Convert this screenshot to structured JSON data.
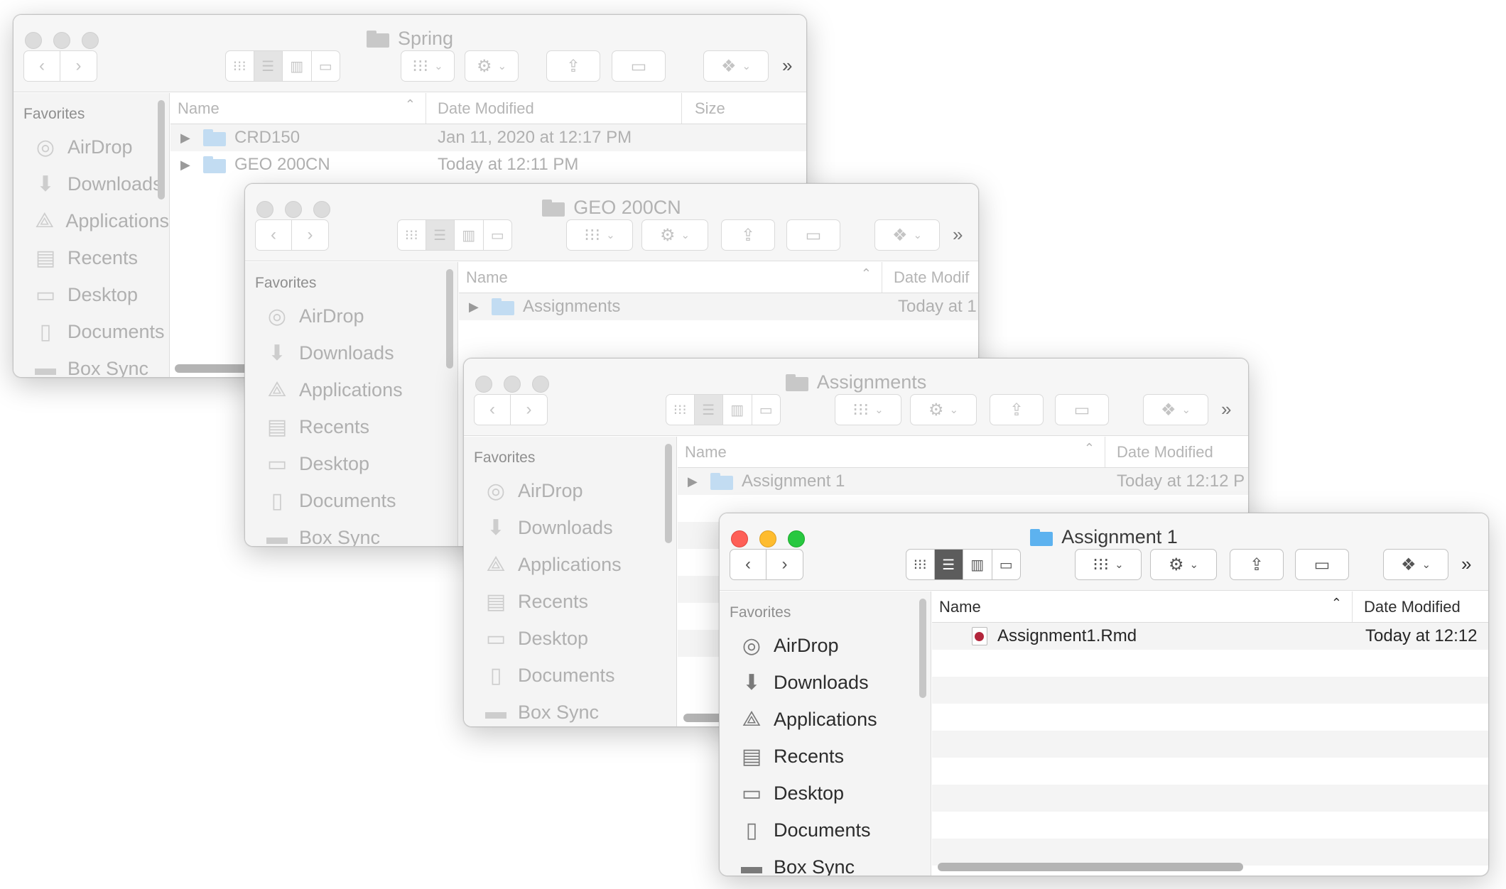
{
  "toolbar": {
    "back": "‹",
    "forward": "›",
    "more": "»",
    "icons": [
      "back-icon",
      "forward-icon",
      "icon-view-icon",
      "list-view-icon",
      "column-view-icon",
      "gallery-view-icon",
      "group-icon",
      "gear-icon",
      "share-icon",
      "tag-icon",
      "dropbox-icon"
    ]
  },
  "sidebar": {
    "heading": "Favorites",
    "items": [
      {
        "label": "AirDrop",
        "icon": "airdrop-icon"
      },
      {
        "label": "Downloads",
        "icon": "downloads-icon"
      },
      {
        "label": "Applications",
        "icon": "applications-icon"
      },
      {
        "label": "Recents",
        "icon": "recents-icon"
      },
      {
        "label": "Desktop",
        "icon": "desktop-icon"
      },
      {
        "label": "Documents",
        "icon": "documents-icon"
      },
      {
        "label": "Box Sync",
        "icon": "folder-icon"
      }
    ]
  },
  "columns": {
    "name": "Name",
    "date": "Date Modified",
    "size": "Size"
  },
  "windows": [
    {
      "title": "Spring",
      "date_header": "Date Modified",
      "rows": [
        {
          "name": "CRD150",
          "date": "Jan 11, 2020 at 12:17 PM"
        },
        {
          "name": "GEO 200CN",
          "date": "Today at 12:11 PM"
        }
      ]
    },
    {
      "title": "GEO 200CN",
      "date_header": "Date Modif",
      "rows": [
        {
          "name": "Assignments",
          "date": "Today at 1"
        }
      ]
    },
    {
      "title": "Assignments",
      "date_header": "Date Modified",
      "rows": [
        {
          "name": "Assignment 1",
          "date": "Today at 12:12 P"
        }
      ]
    },
    {
      "title": "Assignment 1",
      "date_header": "Date Modified",
      "rows": [
        {
          "name": "Assignment1.Rmd",
          "date": "Today at 12:12"
        }
      ]
    }
  ],
  "colors": {
    "red": "#fe5f57",
    "yellow": "#febc2e",
    "green": "#28c840",
    "folder_blue": "#5db2ef"
  }
}
